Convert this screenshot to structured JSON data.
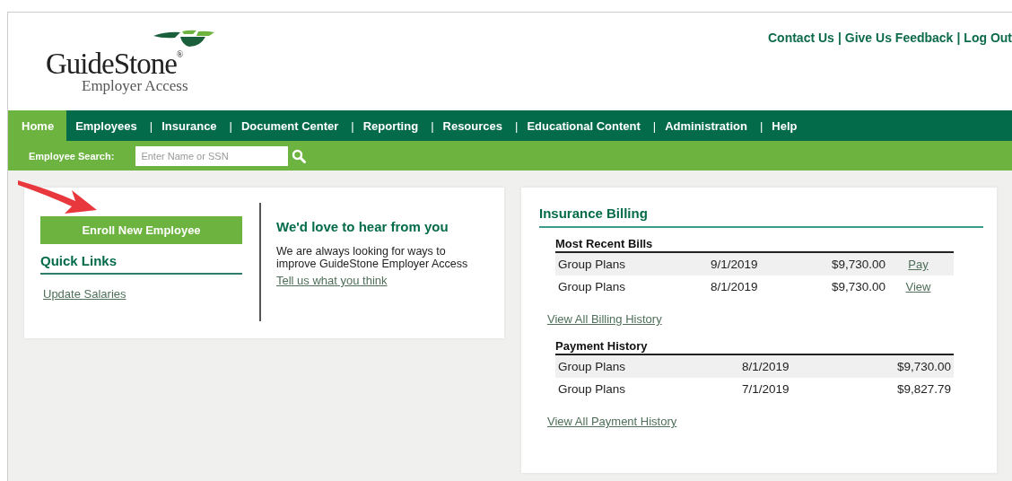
{
  "logo": {
    "name": "GuideStone",
    "registered": "®",
    "subtitle": "Employer Access"
  },
  "top_links": [
    {
      "label": "Contact Us"
    },
    {
      "label": "Give Us Feedback"
    },
    {
      "label": "Log Out"
    }
  ],
  "top_link_separator": "|",
  "nav": [
    {
      "label": "Home",
      "selected": true
    },
    {
      "label": "Employees",
      "selected": false
    },
    {
      "label": "Insurance",
      "selected": false
    },
    {
      "label": "Document Center",
      "selected": false
    },
    {
      "label": "Reporting",
      "selected": false
    },
    {
      "label": "Resources",
      "selected": false
    },
    {
      "label": "Educational Content",
      "selected": false
    },
    {
      "label": "Administration",
      "selected": false
    },
    {
      "label": "Help",
      "selected": false
    }
  ],
  "search": {
    "label": "Employee Search:",
    "placeholder": "Enter Name or SSN"
  },
  "enroll_button": "Enroll New Employee",
  "quick_links": {
    "title": "Quick Links",
    "links": [
      "Update Salaries"
    ]
  },
  "feedback": {
    "title": "We'd love to hear from you",
    "text": "We are always looking for ways to improve GuideStone Employer Access",
    "link": "Tell us what you think"
  },
  "billing": {
    "title": "Insurance Billing",
    "recent": {
      "title": "Most Recent Bills",
      "rows": [
        {
          "plan": "Group Plans",
          "date": "9/1/2019",
          "amount": "$9,730.00",
          "action": "Pay"
        },
        {
          "plan": "Group Plans",
          "date": "8/1/2019",
          "amount": "$9,730.00",
          "action": "View"
        }
      ]
    },
    "recent_link": "View All Billing History",
    "payments": {
      "title": "Payment History",
      "rows": [
        {
          "plan": "Group Plans",
          "date": "8/1/2019",
          "amount": "$9,730.00"
        },
        {
          "plan": "Group Plans",
          "date": "7/1/2019",
          "amount": "$9,827.79"
        }
      ]
    },
    "payments_link": "View All Payment History"
  }
}
